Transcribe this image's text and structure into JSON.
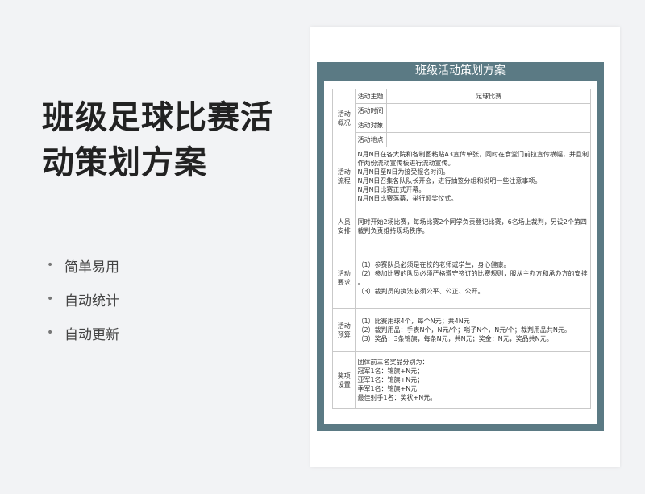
{
  "promo": {
    "title": "班级足球比赛活动策划方案",
    "features": [
      "简单易用",
      "自动统计",
      "自动更新"
    ]
  },
  "document": {
    "title": "班级活动策划方案",
    "overview": {
      "label": "活动概况",
      "rows": [
        {
          "label": "活动主题",
          "value": "足球比赛"
        },
        {
          "label": "活动时间",
          "value": ""
        },
        {
          "label": "活动对象",
          "value": ""
        },
        {
          "label": "活动地点",
          "value": ""
        }
      ]
    },
    "process": {
      "label": "活动流程",
      "lines": [
        "N月N日在各大院和各制图粘贴A3宣传单张，同时在食堂门前拉宣传横幅，并且制",
        "作两份流动宣传板进行流动宣传。",
        "N月N日至N日为接受报名时间。",
        "N月N日召集各队队长开会，进行抽签分组和说明一些注意事项。",
        "N月N日比赛正式开幕。",
        "N月N日比赛落幕，举行颁奖仪式。"
      ]
    },
    "staff": {
      "label": "人员安排",
      "lines": [
        "同时开始2场比赛，每场比赛2个同学负责登记比赛，6名场上裁判，另设2个第四",
        "裁判负责维持现场秩序。"
      ]
    },
    "requirements": {
      "label": "活动要求",
      "lines": [
        "（1）参赛队员必须是在校的老师或学生，身心健康。",
        "（2）参加比赛的队员必须严格遵守签订的比赛规则，服从主办方和承办方的安排",
        "。",
        "（3）裁判员的执法必须公平、公正、公开。"
      ]
    },
    "budget": {
      "label": "活动预算",
      "lines": [
        "（1）比赛用球4个，每个N元；共4N元",
        "（2）裁判用品：手表N个，N元/个；哨子N个，N元/个；裁判用品共N元。",
        "（3）奖品：3条锦旗，每条N元，共N元；奖金：N元，奖品共N元。"
      ]
    },
    "awards": {
      "label": "奖项设置",
      "lines": [
        "团体前三名奖品分别为：",
        "冠军1名：锦旗+N元；",
        "亚军1名：锦旗+N元；",
        "季军1名：锦旗+N元",
        "最佳射手1名：奖状+N元。"
      ]
    }
  }
}
